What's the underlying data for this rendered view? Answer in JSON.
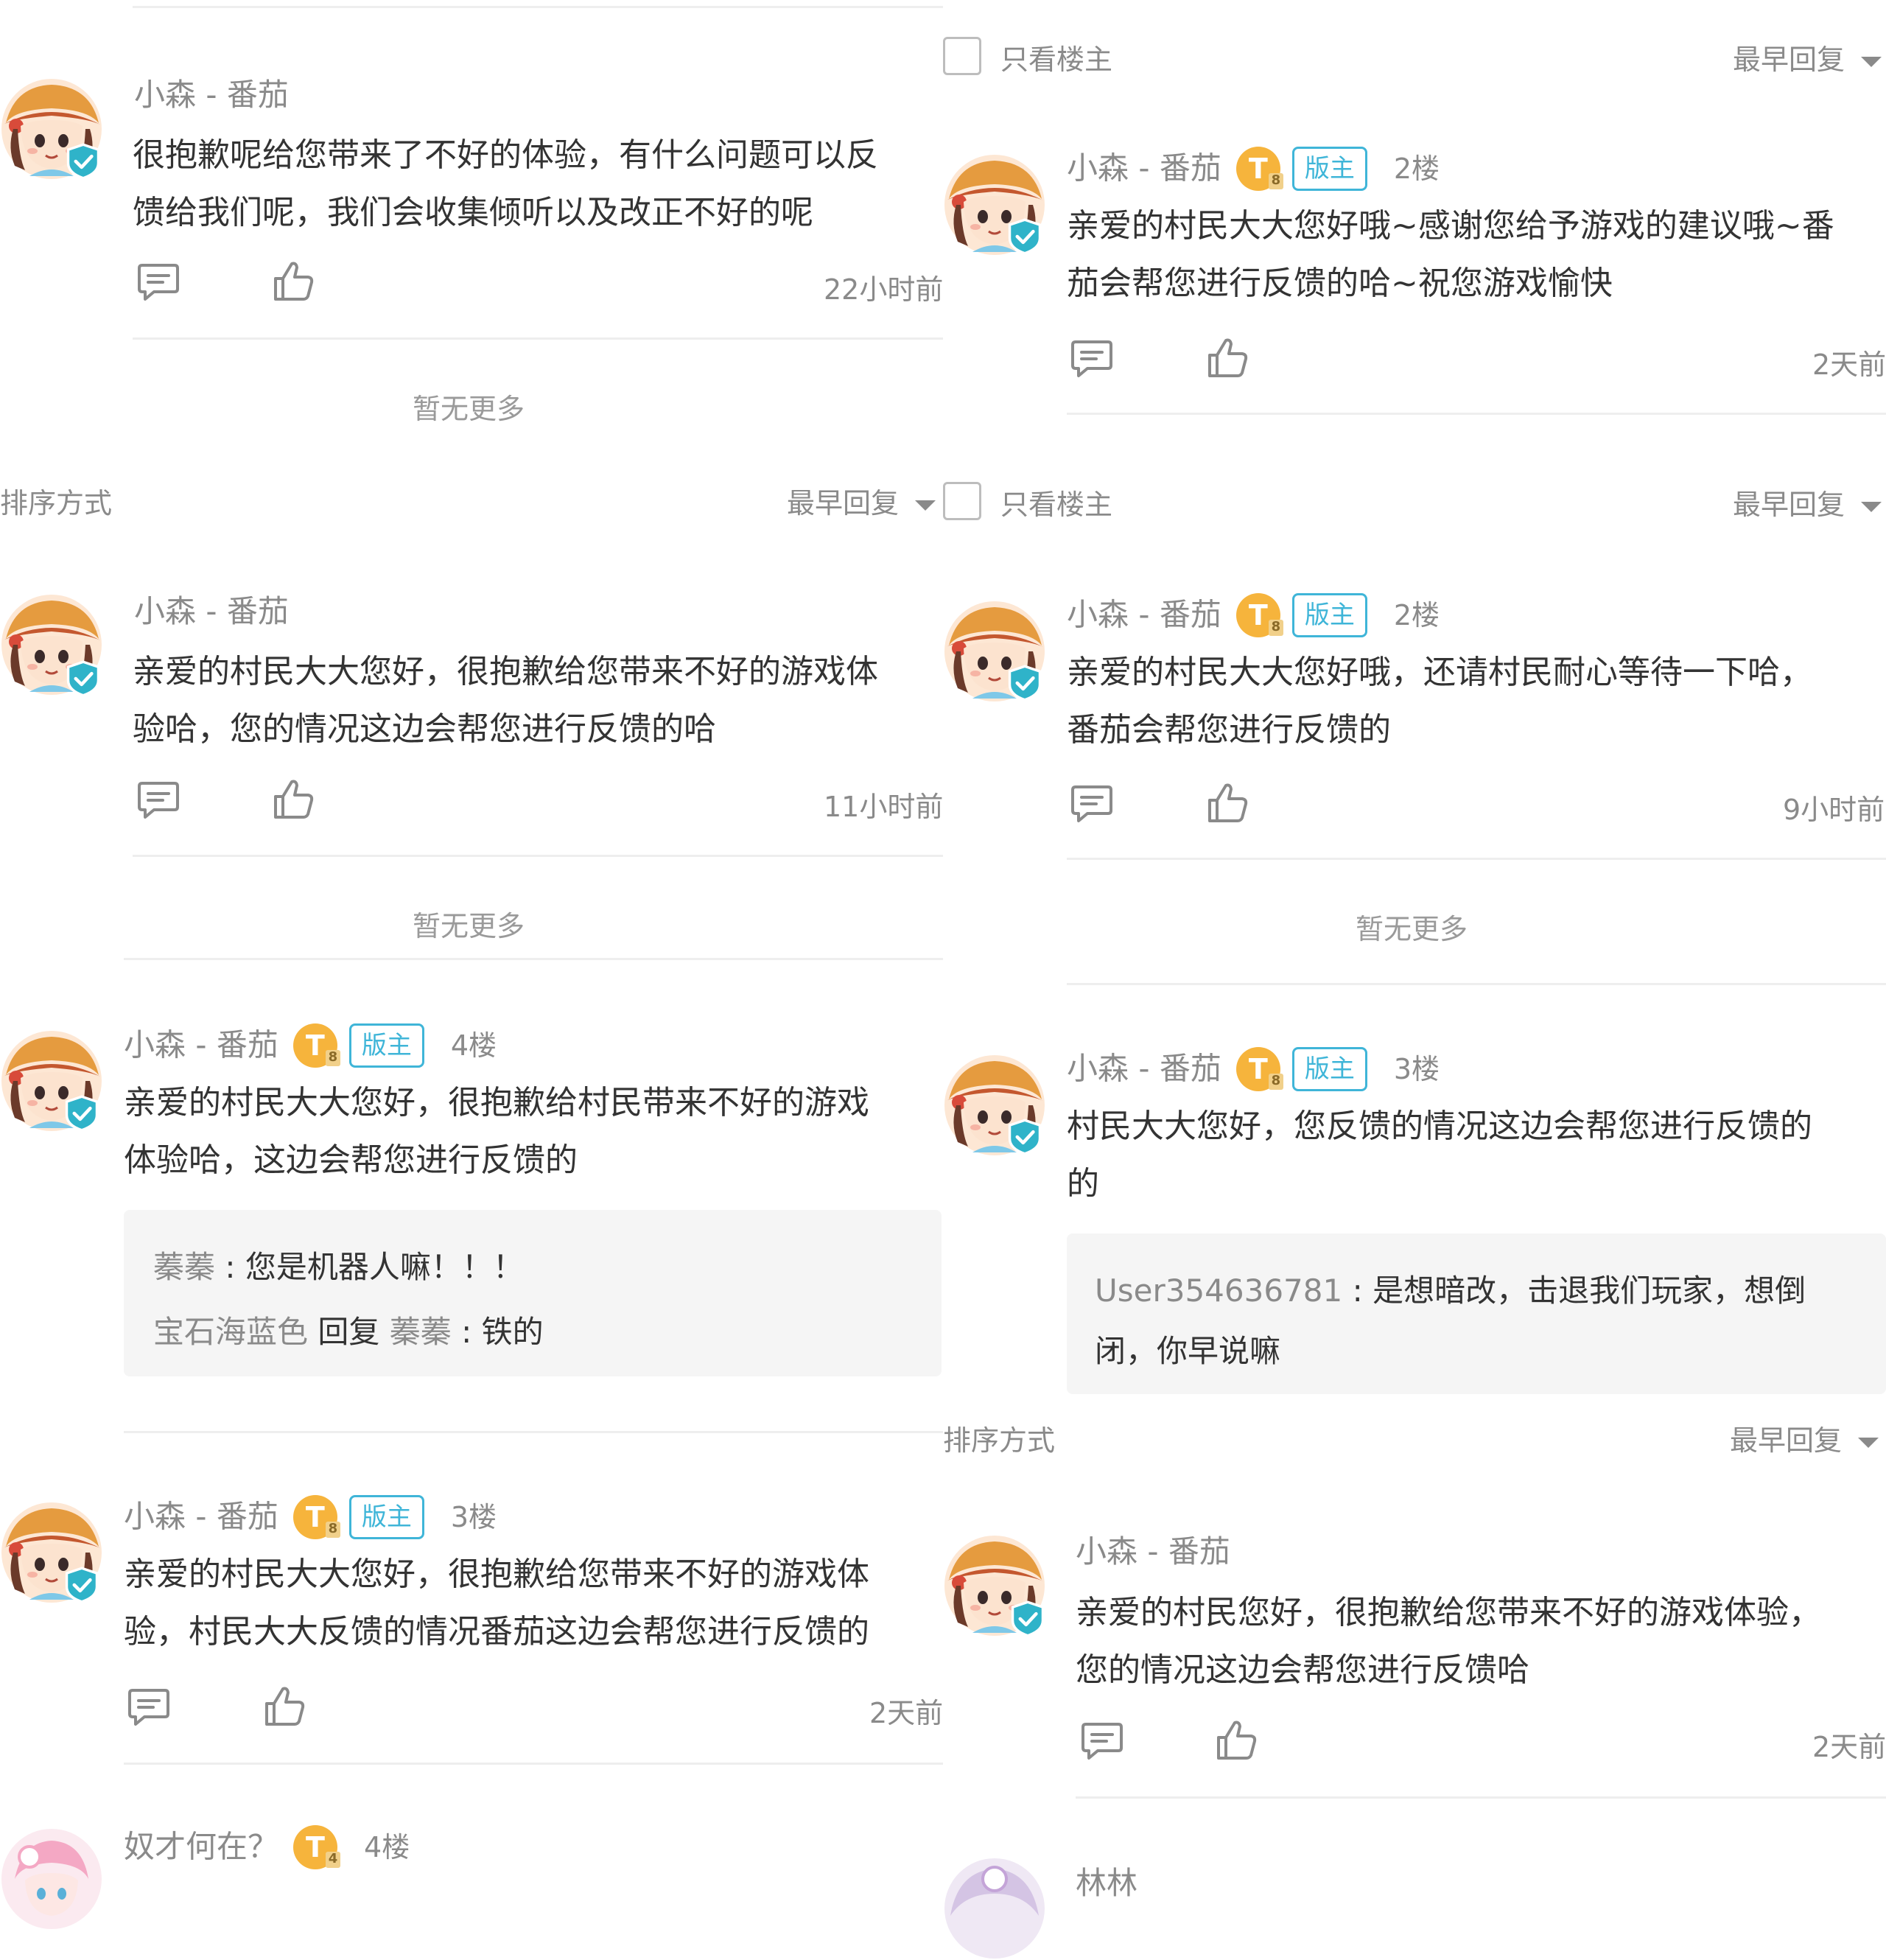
{
  "sort": {
    "label": "排序方式",
    "option": "最早回复",
    "only_op": "只看楼主"
  },
  "cards": {
    "c1": {
      "name": "小森 - 番茄",
      "text1": "很抱歉呢给您带来了不好的体验，有什么问题可以反",
      "text2": "馈给我们呢，我们会收集倾听以及改正不好的呢",
      "time": "22小时前",
      "nomore": "暂无更多"
    },
    "c2": {
      "name": "小森 - 番茄",
      "text1": "亲爱的村民大大您好，很抱歉给您带来不好的游戏体",
      "text2": "验哈，您的情况这边会帮您进行反馈的哈",
      "time": "11小时前",
      "nomore": "暂无更多"
    },
    "c3": {
      "name": "小森 - 番茄",
      "badge": "T",
      "badge_sub": "8",
      "mod": "版主",
      "floor": "4楼",
      "text1": "亲爱的村民大大您好，很抱歉给村民带来不好的游戏",
      "text2": "体验哈，这边会帮您进行反馈的",
      "reply1_user": "蓁蓁",
      "reply1_text": "您是机器人嘛！！！",
      "reply2_user": "宝石海蓝色",
      "reply2_mid": "回复",
      "reply2_target": "蓁蓁",
      "reply2_text": "铁的"
    },
    "c4": {
      "name": "小森 - 番茄",
      "badge": "T",
      "badge_sub": "8",
      "mod": "版主",
      "floor": "3楼",
      "text1": "亲爱的村民大大您好，很抱歉给您带来不好的游戏体",
      "text2": "验，村民大大反馈的情况番茄这边会帮您进行反馈的",
      "time": "2天前"
    },
    "c5": {
      "name": "奴才何在？",
      "badge": "T",
      "badge_sub": "4",
      "floor": "4楼"
    },
    "c6": {
      "name": "小森 - 番茄",
      "badge": "T",
      "badge_sub": "8",
      "mod": "版主",
      "floor": "2楼",
      "text1": "亲爱的村民大大您好哦~感谢您给予游戏的建议哦~番",
      "text2": "茄会帮您进行反馈的哈~祝您游戏愉快",
      "time": "2天前"
    },
    "c7": {
      "name": "小森 - 番茄",
      "badge": "T",
      "badge_sub": "8",
      "mod": "版主",
      "floor": "2楼",
      "text1": "亲爱的村民大大您好哦，还请村民耐心等待一下哈，",
      "text2": "番茄会帮您进行反馈的",
      "time": "9小时前",
      "nomore": "暂无更多"
    },
    "c8": {
      "name": "小森 - 番茄",
      "badge": "T",
      "badge_sub": "8",
      "mod": "版主",
      "floor": "3楼",
      "text1": "村民大大您好，您反馈的情况这边会帮您进行反馈的",
      "text2": "的",
      "reply1_user": "User354636781",
      "reply1_text": "是想暗改，击退我们玩家，想倒",
      "reply1_text2": "闭，你早说嘛"
    },
    "c9": {
      "name": "小森 - 番茄",
      "text1": "亲爱的村民您好，很抱歉给您带来不好的游戏体验，",
      "text2": "您的情况这边会帮您进行反馈哈",
      "time": "2天前"
    },
    "c10": {
      "name": "林林"
    }
  },
  "colors": {
    "accent": "#3fb5d8",
    "gold": "#f6b43c",
    "muted": "#8a8a8a",
    "text": "#333333",
    "divider": "#eeeeee",
    "reply_bg": "#f5f5f5"
  },
  "icons": [
    "comment-icon",
    "thumbs-up-icon",
    "checkbox-icon",
    "dropdown-triangle-icon",
    "verified-check-icon"
  ]
}
